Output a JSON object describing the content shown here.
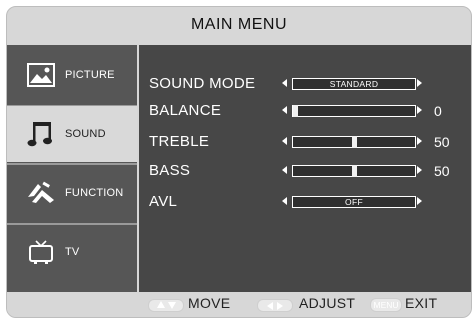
{
  "window": {
    "title": "MAIN  MENU"
  },
  "sidebar": {
    "items": [
      {
        "label": "PICTURE",
        "icon": "picture-icon",
        "active": false
      },
      {
        "label": "SOUND",
        "icon": "music-note-icon",
        "active": true
      },
      {
        "label": "FUNCTION",
        "icon": "function-icon",
        "active": false
      },
      {
        "label": "TV",
        "icon": "tv-icon",
        "active": false
      }
    ]
  },
  "settings": {
    "sound_mode": {
      "label": "SOUND MODE",
      "value": "STANDARD"
    },
    "balance": {
      "label": "BALANCE",
      "value": "0",
      "level": 0
    },
    "treble": {
      "label": "TREBLE",
      "value": "50",
      "level": 50
    },
    "bass": {
      "label": "BASS",
      "value": "50",
      "level": 50
    },
    "avl": {
      "label": "AVL",
      "value": "OFF"
    }
  },
  "footer": {
    "move_label": "MOVE",
    "adjust_label": "ADJUST",
    "menu_key": "MENU",
    "exit_label": "EXIT"
  },
  "colors": {
    "panel_background": "#d7d7d7",
    "sidebar_background": "#565656",
    "content_background": "#474747",
    "active_item": "#d9d9d9",
    "text_light": "#ffffff",
    "text_dark": "#222222"
  }
}
